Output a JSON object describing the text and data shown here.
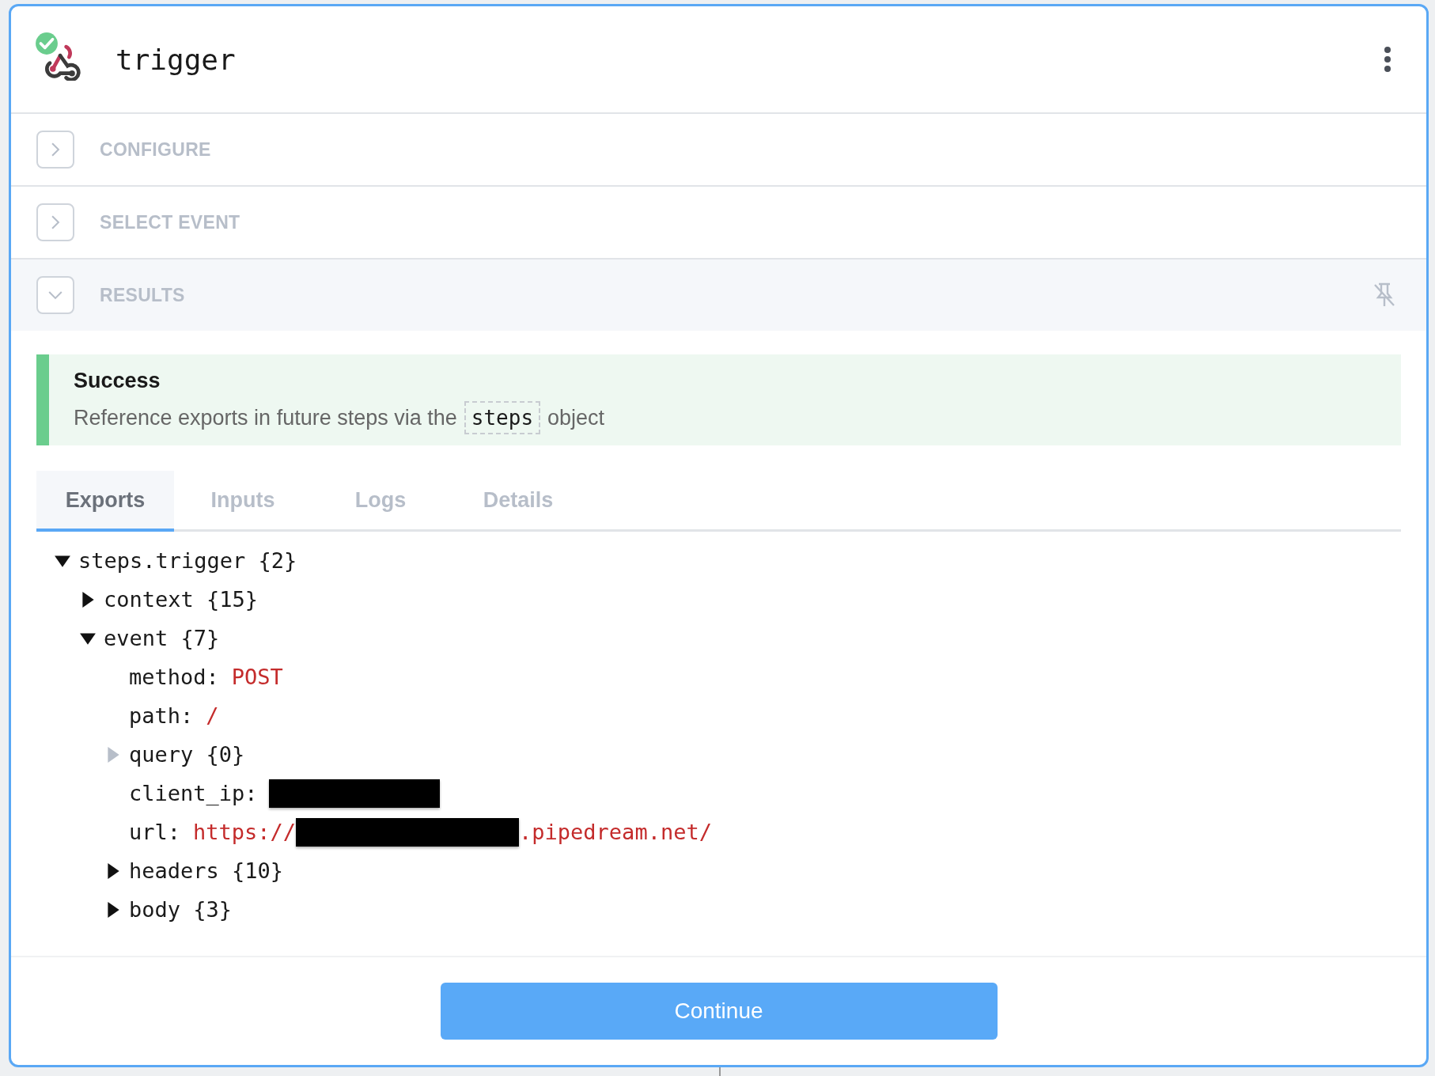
{
  "header": {
    "title": "trigger",
    "succeeded": true
  },
  "sections": [
    {
      "label": "CONFIGURE",
      "expanded": false,
      "pinnable": false
    },
    {
      "label": "SELECT EVENT",
      "expanded": false,
      "pinnable": false
    },
    {
      "label": "RESULTS",
      "expanded": true,
      "pinnable": true
    }
  ],
  "alert": {
    "title": "Success",
    "text_before": "Reference exports in future steps via the",
    "code": "steps",
    "text_after": "object"
  },
  "tabs": [
    {
      "label": "Exports",
      "selected": true
    },
    {
      "label": "Inputs",
      "selected": false
    },
    {
      "label": "Logs",
      "selected": false
    },
    {
      "label": "Details",
      "selected": false
    }
  ],
  "tree": [
    {
      "kind": "object",
      "label": "steps.trigger {2}",
      "expanded": true,
      "empty": false,
      "children": [
        {
          "kind": "object",
          "label": "context {15}",
          "expanded": false,
          "empty": false
        },
        {
          "kind": "object",
          "label": "event {7}",
          "expanded": true,
          "empty": false,
          "children": [
            {
              "kind": "value",
              "key": "method:",
              "value": "POST",
              "redacted": false
            },
            {
              "kind": "value",
              "key": "path:",
              "value": "/",
              "redacted": false
            },
            {
              "kind": "object",
              "label": "query {0}",
              "expanded": false,
              "empty": true
            },
            {
              "kind": "value",
              "key": "client_ip:",
              "redacted": true
            },
            {
              "kind": "value",
              "key": "url:",
              "value": "https://",
              "redacted": true,
              "value_end": ".pipedream.net/"
            },
            {
              "kind": "object",
              "label": "headers {10}",
              "expanded": false,
              "empty": false
            },
            {
              "kind": "object",
              "label": "body {3}",
              "expanded": false,
              "empty": false
            }
          ]
        }
      ]
    }
  ],
  "footer": {
    "button": "Continue"
  }
}
